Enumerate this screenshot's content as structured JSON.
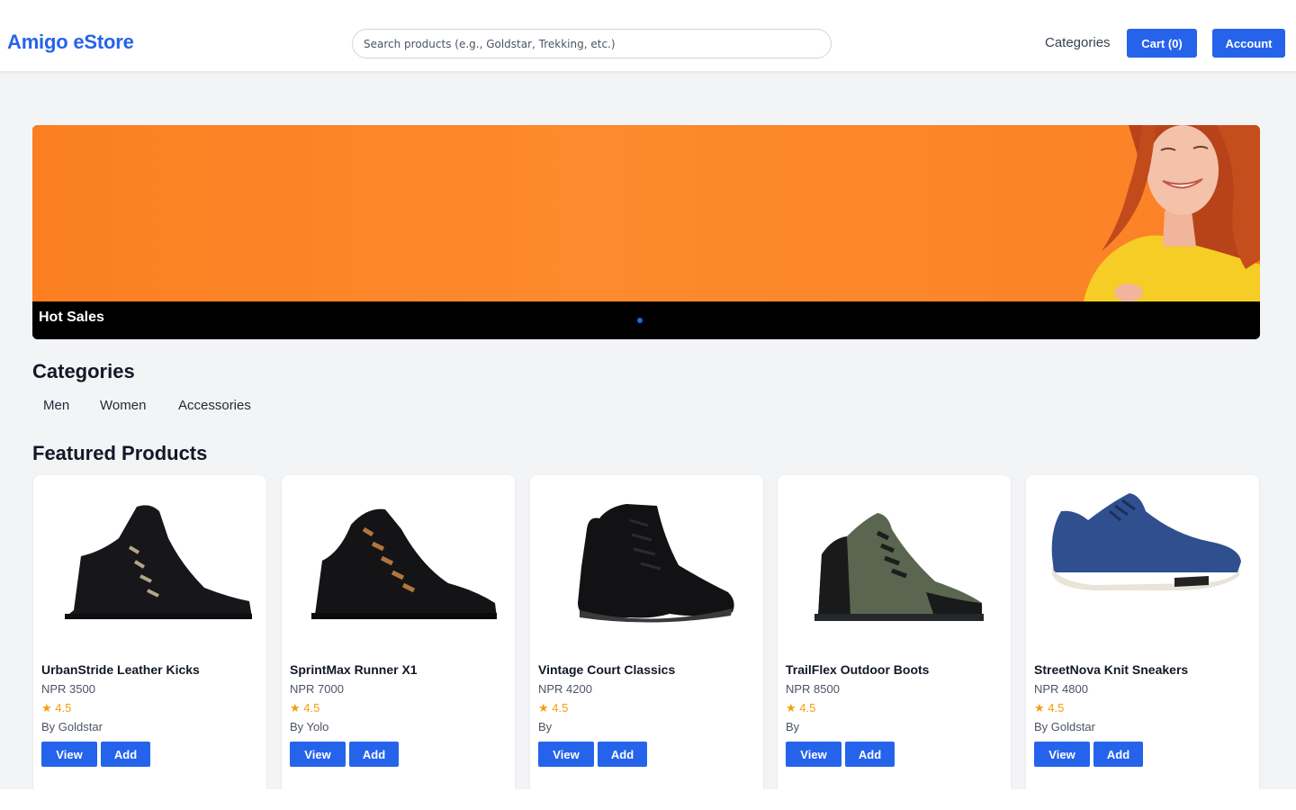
{
  "header": {
    "logo": "Amigo eStore",
    "search_placeholder": "Search products (e.g., Goldstar, Trekking, etc.)",
    "nav_categories": "Categories",
    "cart_label": "Cart (0)",
    "account_label": "Account"
  },
  "hero": {
    "caption": "Hot Sales",
    "active_slide": 1,
    "slide_count": 1
  },
  "categories": {
    "title": "Categories",
    "items": [
      "Men",
      "Women",
      "Accessories"
    ]
  },
  "featured": {
    "title": "Featured Products",
    "products": [
      {
        "name": "UrbanStride Leather Kicks",
        "price": "NPR 3500",
        "rating": "4.5",
        "brand": "By Goldstar",
        "image": "black-suede-boot"
      },
      {
        "name": "SprintMax Runner X1",
        "price": "NPR 7000",
        "rating": "4.5",
        "brand": "By Yolo",
        "image": "black-hiking-boot"
      },
      {
        "name": "Vintage Court Classics",
        "price": "NPR 4200",
        "rating": "4.5",
        "brand": "By",
        "image": "black-leather-boot"
      },
      {
        "name": "TrailFlex Outdoor Boots",
        "price": "NPR 8500",
        "rating": "4.5",
        "brand": "By",
        "image": "olive-hiking-boot"
      },
      {
        "name": "StreetNova Knit Sneakers",
        "price": "NPR 4800",
        "rating": "4.5",
        "brand": "By Goldstar",
        "image": "blue-knit-sneaker"
      }
    ],
    "view_label": "View",
    "add_label": "Add"
  },
  "colors": {
    "accent": "#2563eb",
    "hero_orange": "#fd8a2e",
    "star": "#f59e0b"
  }
}
